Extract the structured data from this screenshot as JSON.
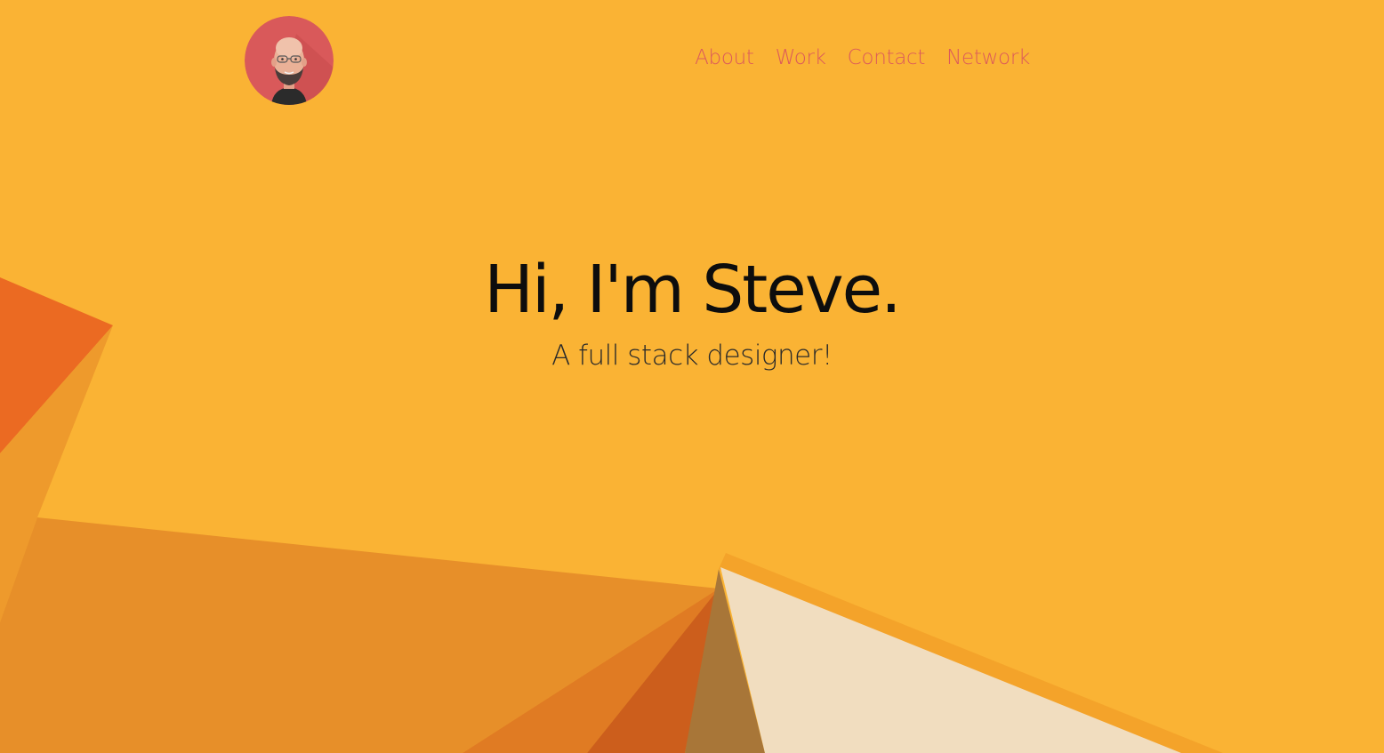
{
  "header": {
    "avatar_alt": "Steve avatar",
    "nav": [
      {
        "label": "About"
      },
      {
        "label": "Work"
      },
      {
        "label": "Contact"
      },
      {
        "label": "Network"
      }
    ]
  },
  "hero": {
    "title": "Hi, I'm Steve.",
    "subtitle": "A full stack designer!"
  },
  "colors": {
    "background": "#fab334",
    "nav_link": "#dc5b5a",
    "title": "#0d0d0d",
    "avatar_bg": "#d9595a"
  }
}
